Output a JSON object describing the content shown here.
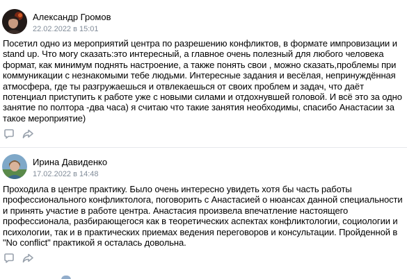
{
  "posts": [
    {
      "author": "Александр Громов",
      "date": "22.02.2022 в 15:01",
      "text": "Посетил одно из мероприятий центра по разрешению конфликтов, в формате импровизации и stand up. Что могу сказать:это интересный, а главное очень полезный для любого человека формат, как минимум поднять настроение, а также понять свои , можно сказать,проблемы при коммуникации с незнакомыми тебе людьми. Интересные задания и весёлая, непринуждённая атмосфера, где ты разгружаешься и отвлекаешься от своих проблем и задач, что даёт потенциал приступить к работе уже с новыми силами и отдохнувшей головой. И всё это за одно занятие по полтора -два часа) я считаю что такие занятия необходимы, спасибо Анастасии за такое мероприятие)",
      "icons": [
        "reply-icon",
        "share-icon"
      ]
    },
    {
      "author": "Ирина Давиденко",
      "date": "17.02.2022 в 14:48",
      "text": "Проходила в центре практику. Было очень интересно увидеть хотя бы часть работы профессионального конфликтолога, поговорить с Анастасией о нюансах данной специальности и принять участие в работе центра. Анастасия произвела впечатление настоящего профессионала, разбирающегося как в теоретических аспектах конфликтологии, социологии и психологии, так и в практических приемах ведения переговоров и консультации. Пройденной в \"No conflict\" практикой я осталась довольна.",
      "icons": [
        "reply-icon",
        "share-icon"
      ]
    }
  ],
  "colors": {
    "author": "#000000",
    "date": "#818c99",
    "text": "#000000",
    "icon": "#99a2ad",
    "divider": "#e7e8ec"
  }
}
